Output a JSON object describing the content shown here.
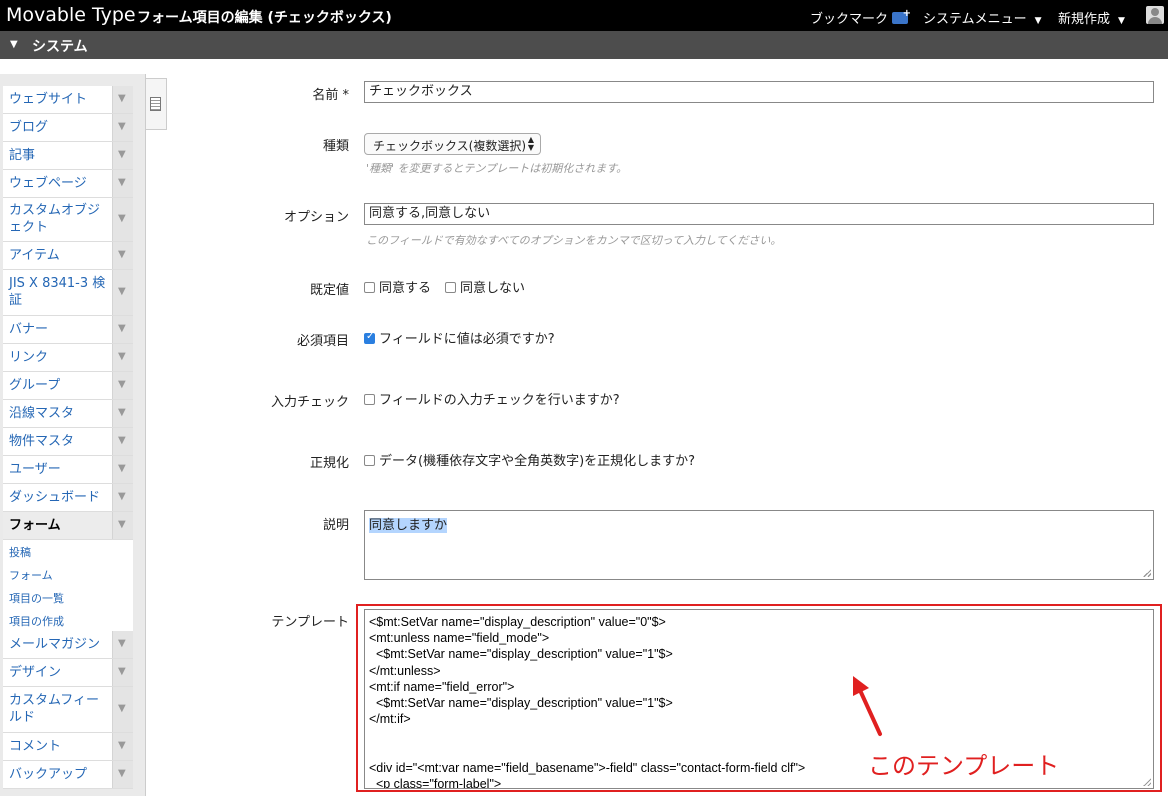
{
  "app": {
    "brand": "Movable Type",
    "page_title": "フォーム項目の編集 (チェックボックス)"
  },
  "top_menu": {
    "bookmark": "ブックマーク",
    "system_menu": "システムメニュー",
    "new": "新規作成"
  },
  "context": {
    "label": "システム"
  },
  "sidebar": {
    "items": [
      {
        "label": "ウェブサイト"
      },
      {
        "label": "ブログ"
      },
      {
        "label": "記事"
      },
      {
        "label": "ウェブページ"
      },
      {
        "label": "カスタムオブジェクト"
      },
      {
        "label": "アイテム"
      },
      {
        "label": "JIS X 8341-3 検証"
      },
      {
        "label": "バナー"
      },
      {
        "label": "リンク"
      },
      {
        "label": "グループ"
      },
      {
        "label": "沿線マスタ"
      },
      {
        "label": "物件マスタ"
      },
      {
        "label": "ユーザー"
      },
      {
        "label": "ダッシュボード"
      },
      {
        "label": "フォーム"
      },
      {
        "label": "メールマガジン"
      },
      {
        "label": "デザイン"
      },
      {
        "label": "カスタムフィールド"
      },
      {
        "label": "コメント"
      },
      {
        "label": "バックアップ"
      }
    ],
    "form_subitems": [
      "投稿",
      "フォーム",
      "項目の一覧",
      "項目の作成"
    ]
  },
  "form": {
    "name_label": "名前",
    "name_required_mark": "*",
    "name_value": "チェックボックス",
    "type_label": "種類",
    "type_value": "チェックボックス(複数選択)",
    "type_hint": "'種類' を変更するとテンプレートは初期化されます。",
    "options_label": "オプション",
    "options_value": "同意する,同意しない",
    "options_hint": "このフィールドで有効なすべてのオプションをカンマで区切って入力してください。",
    "default_label": "既定値",
    "default_opt1": "同意する",
    "default_opt2": "同意しない",
    "required_label": "必須項目",
    "required_text": "フィールドに値は必須ですか?",
    "validate_label": "入力チェック",
    "validate_text": "フィールドの入力チェックを行いますか?",
    "normalize_label": "正規化",
    "normalize_text": "データ(機種依存文字や全角英数字)を正規化しますか?",
    "desc_label": "説明",
    "desc_value": "同意しますか",
    "template_label": "テンプレート",
    "template_value": "<$mt:SetVar name=\"display_description\" value=\"0\"$>\n<mt:unless name=\"field_mode\">\n  <$mt:SetVar name=\"display_description\" value=\"1\"$>\n</mt:unless>\n<mt:if name=\"field_error\">\n  <$mt:SetVar name=\"display_description\" value=\"1\"$>\n</mt:if>\n\n\n<div id=\"<mt:var name=\"field_basename\">-field\" class=\"contact-form-field clf\">\n  <p class=\"form-label\">"
  },
  "annotation": {
    "text": "このテンプレート",
    "color": "#e02020"
  }
}
